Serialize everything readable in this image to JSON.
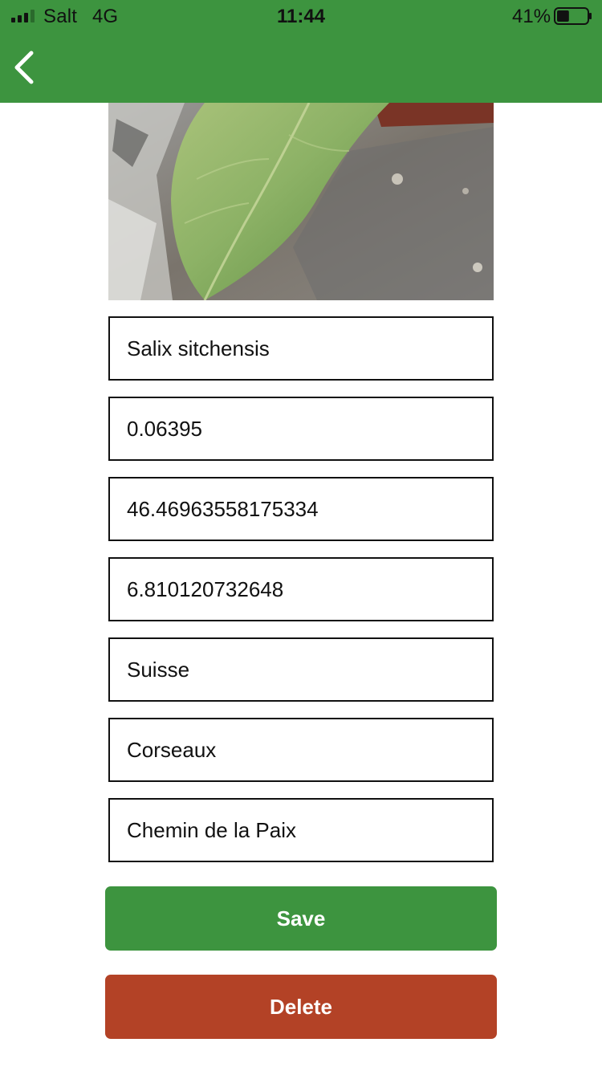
{
  "status_bar": {
    "carrier": "Salt",
    "network": "4G",
    "time": "11:44",
    "battery_percent": "41%",
    "battery_level": 0.41,
    "signal_icon": "cellular-signal-icon",
    "battery_icon": "battery-icon"
  },
  "header": {
    "back_icon": "chevron-left-icon",
    "background_color": "#3d943f"
  },
  "photo": {
    "subject": "leaf-photo"
  },
  "form": {
    "species": "Salix sitchensis",
    "score": "0.06395",
    "latitude": "46.46963558175334",
    "longitude": "6.810120732648",
    "country": "Suisse",
    "city": "Corseaux",
    "street": "Chemin de la Paix"
  },
  "actions": {
    "save_label": "Save",
    "delete_label": "Delete",
    "save_color": "#3d943f",
    "delete_color": "#b34226"
  }
}
